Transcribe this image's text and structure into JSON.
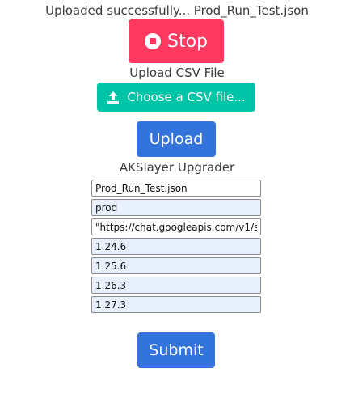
{
  "status": {
    "message": "Uploaded successfully... Prod_Run_Test.json"
  },
  "stop_button": {
    "label": "Stop",
    "icon": "stop-circle-icon",
    "color": "#ff3860"
  },
  "upload_section": {
    "label": "Upload CSV File",
    "choose_button_label": "Choose a CSV file...",
    "choose_button_icon": "upload-icon",
    "choose_button_color": "#00c4a7",
    "upload_button_label": "Upload",
    "upload_button_color": "#3273dc"
  },
  "upgrader": {
    "title": "AKSlayer Upgrader",
    "fields": [
      {
        "value": "Prod_Run_Test.json"
      },
      {
        "value": "prod"
      },
      {
        "value": "\"https://chat.googleapis.com/v1/s"
      },
      {
        "value": "1.24.6"
      },
      {
        "value": "1.25.6"
      },
      {
        "value": "1.26.3"
      },
      {
        "value": "1.27.3"
      }
    ],
    "submit_label": "Submit",
    "submit_color": "#3273dc"
  }
}
